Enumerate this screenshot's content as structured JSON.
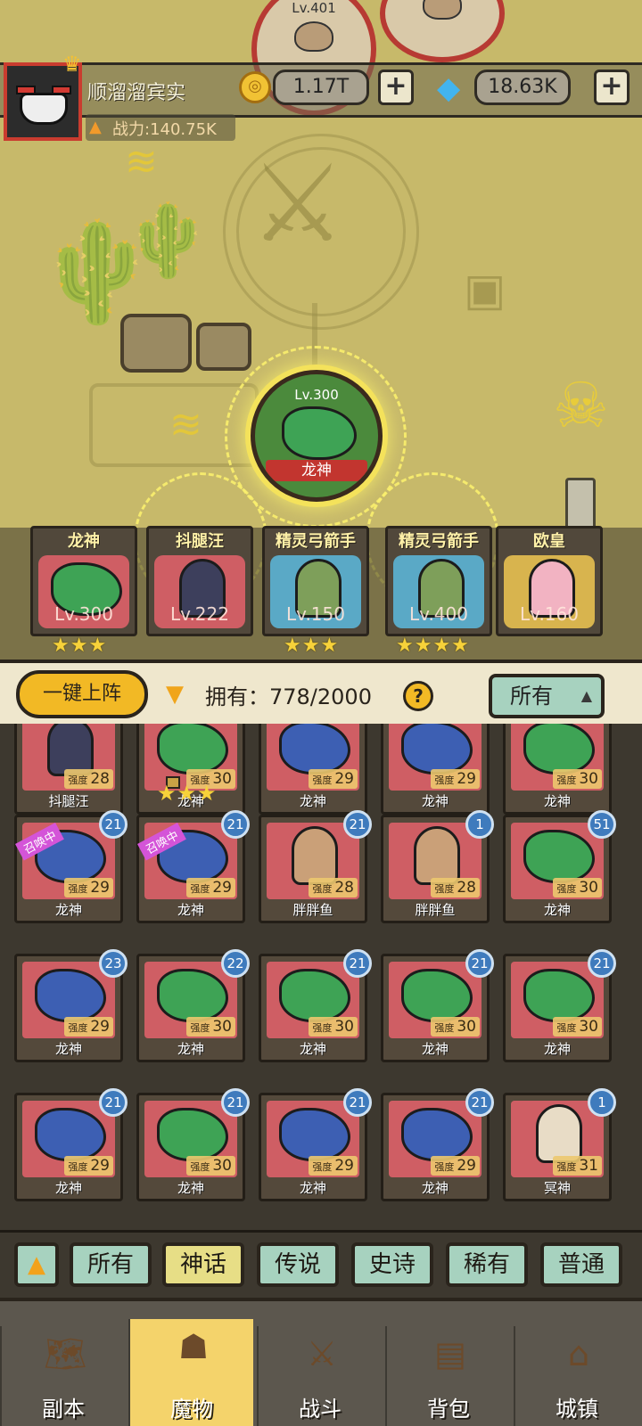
{
  "enemies": [
    {
      "level": "Lv.401"
    }
  ],
  "player": {
    "name": "顺溜溜宾实",
    "power": "战力:140.75K"
  },
  "resources": {
    "coins": "1.17T",
    "gems": "18.63K",
    "plus": "+"
  },
  "active_monster": {
    "level": "Lv.300",
    "name": "龙神"
  },
  "team": [
    {
      "name": "龙神",
      "level": "Lv.300",
      "stars": "★★★",
      "art": "green"
    },
    {
      "name": "抖腿汪",
      "level": "Lv.222",
      "stars": "",
      "art": "dark"
    },
    {
      "name": "精灵弓箭手",
      "level": "Lv.150",
      "stars": "★★★",
      "art": "archer"
    },
    {
      "name": "精灵弓箭手",
      "level": "Lv.400",
      "stars": "★★★★",
      "art": "archer"
    },
    {
      "name": "欧皇",
      "level": "Lv.160",
      "stars": "",
      "art": "gold"
    }
  ],
  "roster_header": {
    "deploy_label": "一键上阵",
    "owned_label": "拥有：778/2000",
    "help": "?",
    "filter_label": "所有"
  },
  "strength_label": "强度",
  "roster_rows": [
    [
      {
        "name": "抖腿汪",
        "strength": "28",
        "art": "dark"
      },
      {
        "name": "龙神",
        "strength": "30",
        "art": "green",
        "locked": true
      },
      {
        "name": "龙神",
        "strength": "29",
        "art": "blue"
      },
      {
        "name": "龙神",
        "strength": "29",
        "art": "blue"
      },
      {
        "name": "龙神",
        "strength": "30",
        "art": "green"
      }
    ],
    [
      {
        "name": "龙神",
        "strength": "29",
        "art": "blue",
        "count": "21",
        "ribbon": "召唤中"
      },
      {
        "name": "龙神",
        "strength": "29",
        "art": "blue",
        "count": "21",
        "ribbon": "召唤中"
      },
      {
        "name": "胖胖鱼",
        "strength": "28",
        "art": "mermaid",
        "count": "21"
      },
      {
        "name": "胖胖鱼",
        "strength": "28",
        "art": "mermaid",
        "count": "1"
      },
      {
        "name": "龙神",
        "strength": "30",
        "art": "green",
        "count": "51"
      }
    ],
    [
      {
        "name": "龙神",
        "strength": "29",
        "art": "blue",
        "count": "23"
      },
      {
        "name": "龙神",
        "strength": "30",
        "art": "green",
        "count": "22"
      },
      {
        "name": "龙神",
        "strength": "30",
        "art": "green",
        "count": "21"
      },
      {
        "name": "龙神",
        "strength": "30",
        "art": "green",
        "count": "21"
      },
      {
        "name": "龙神",
        "strength": "30",
        "art": "green",
        "count": "21"
      }
    ],
    [
      {
        "name": "龙神",
        "strength": "29",
        "art": "blue",
        "count": "21"
      },
      {
        "name": "龙神",
        "strength": "30",
        "art": "green",
        "count": "21"
      },
      {
        "name": "龙神",
        "strength": "29",
        "art": "blue",
        "count": "21"
      },
      {
        "name": "龙神",
        "strength": "29",
        "art": "blue",
        "count": "21"
      },
      {
        "name": "冥神",
        "strength": "31",
        "art": "angel",
        "count": "1"
      }
    ]
  ],
  "row_stars": "★★★",
  "rarity_tabs": [
    {
      "label": "所有",
      "active": false
    },
    {
      "label": "神话",
      "active": true
    },
    {
      "label": "传说",
      "active": false
    },
    {
      "label": "史诗",
      "active": false
    },
    {
      "label": "稀有",
      "active": false
    },
    {
      "label": "普通",
      "active": false
    }
  ],
  "nav": [
    {
      "label": "副本",
      "icon": "map-icon",
      "active": false
    },
    {
      "label": "魔物",
      "icon": "monster-icon",
      "active": true
    },
    {
      "label": "战斗",
      "icon": "swords-icon",
      "active": false
    },
    {
      "label": "背包",
      "icon": "backpack-icon",
      "active": false
    },
    {
      "label": "城镇",
      "icon": "shop-icon",
      "active": false
    }
  ],
  "colors": {
    "accent": "#f2b925",
    "mint": "#a7d2bf",
    "card_bg": "#cf5e64",
    "count_badge": "#3f7bbd"
  }
}
